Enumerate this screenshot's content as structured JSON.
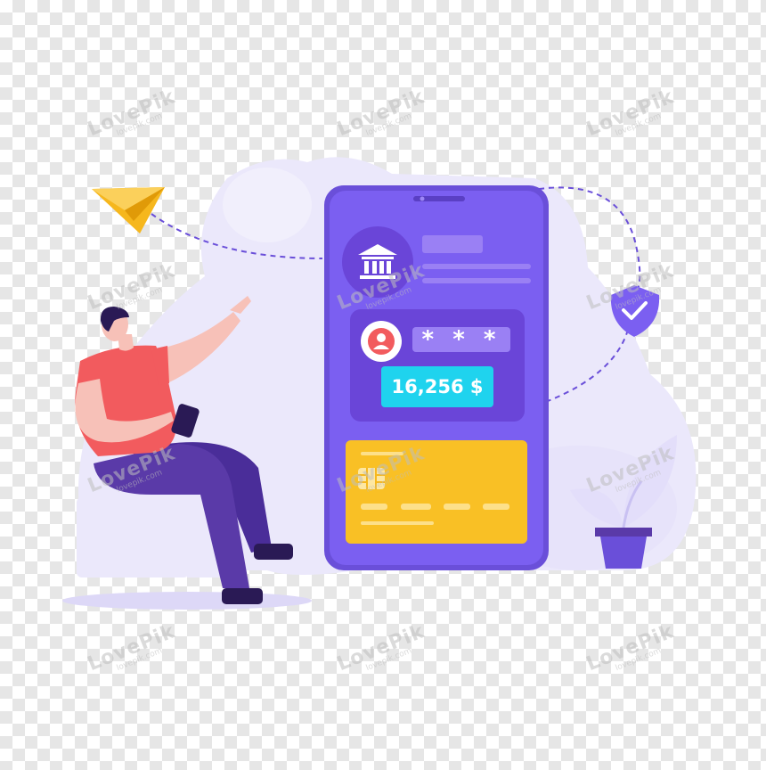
{
  "illustration": {
    "theme": "mobile banking",
    "balance_text": "16,256 $",
    "pin_mask": "* * *",
    "icons": [
      "bank-icon",
      "user-icon",
      "shield-check-icon",
      "paper-plane-icon",
      "card-chip-icon",
      "potted-plant-icon"
    ]
  },
  "watermark": {
    "brand": "LovePik",
    "site": "lovepik.com"
  },
  "colors": {
    "phone_body": "#7b5ff1",
    "phone_frame": "#6a4fd9",
    "panel": "#6a45d8",
    "balance_badge": "#1fd3ee",
    "card": "#fbc52a",
    "shirt": "#f25b5e",
    "pants": "#5a3aa8",
    "plane": "#f6b71d",
    "background_blob": "#eceafb"
  }
}
